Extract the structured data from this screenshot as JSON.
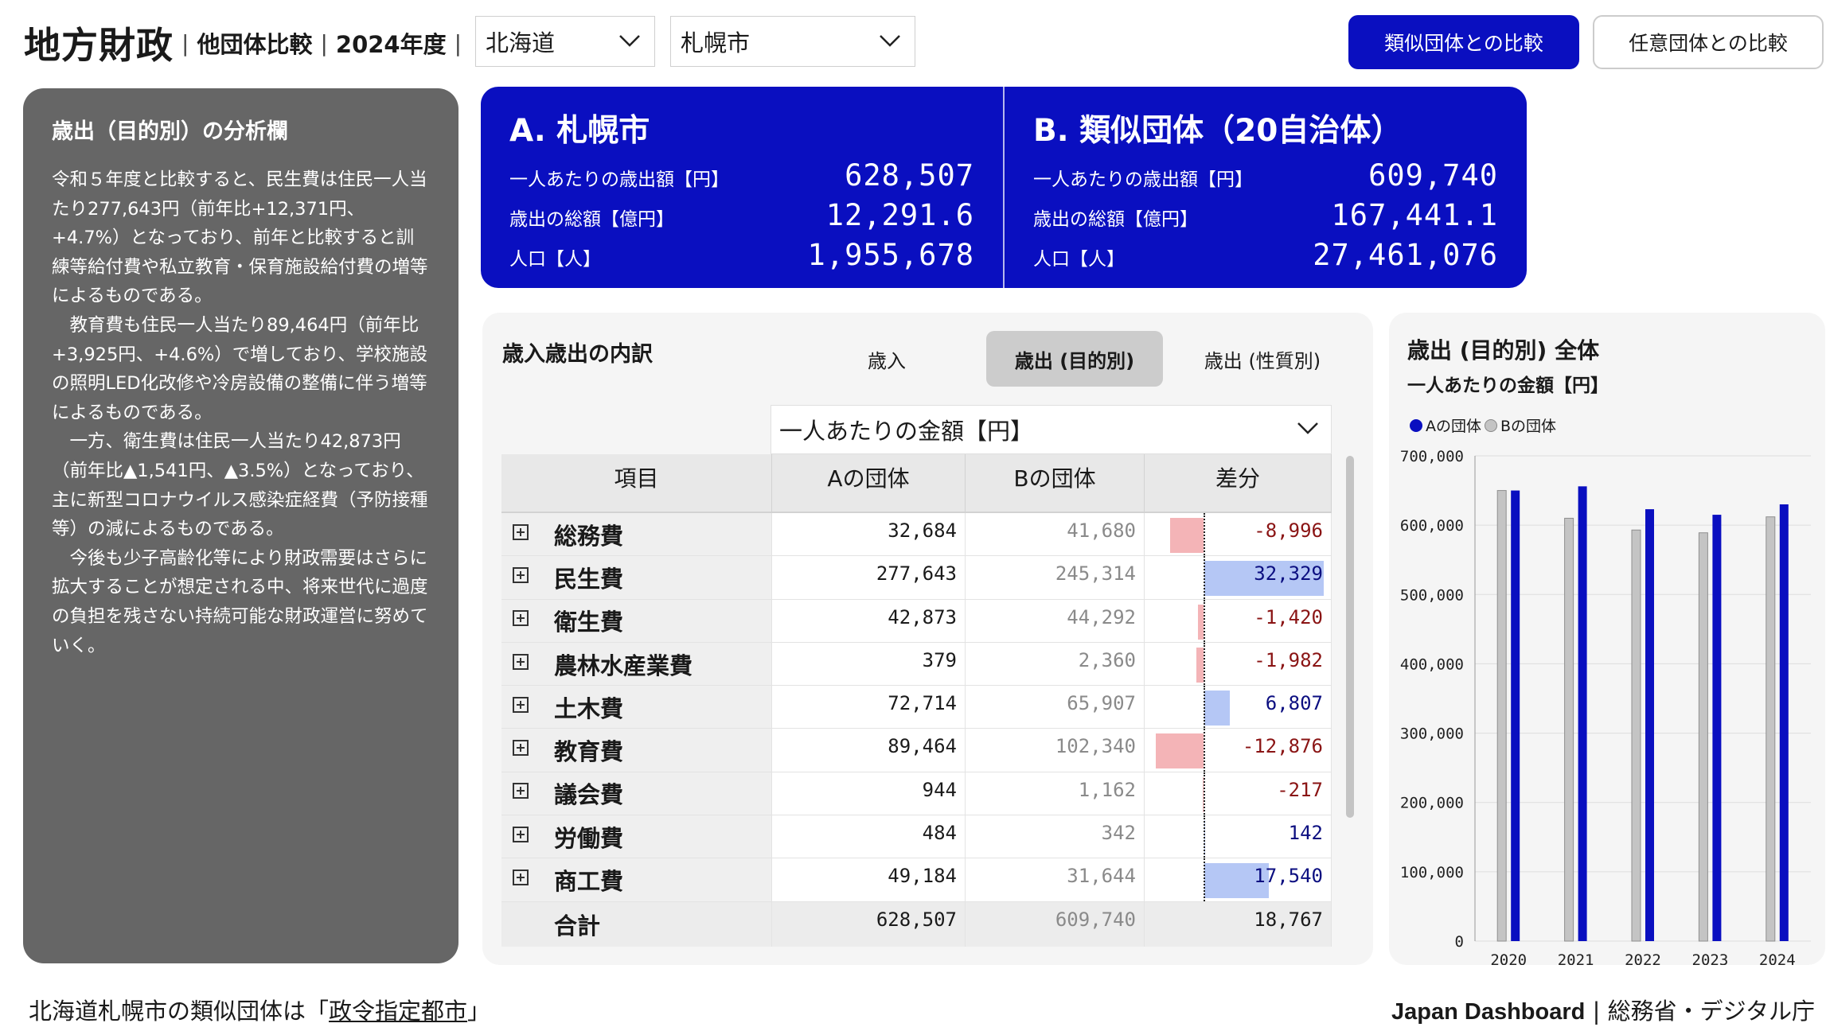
{
  "header": {
    "title": "地方財政",
    "separator": "|",
    "subtitle": "他団体比較",
    "year": "2024年度",
    "prefecture": "北海道",
    "city": "札幌市",
    "btn_similar": "類似団体との比較",
    "btn_any": "任意団体との比較"
  },
  "analysis": {
    "title": "歳出（目的別）の分析欄",
    "body": "令和５年度と比較すると、民生費は住民一人当たり277,643円（前年比+12,371円、+4.7%）となっており、前年と比較すると訓練等給付費や私立教育・保育施設給付費の増等によるものである。\n　教育費も住民一人当たり89,464円（前年比+3,925円、+4.6%）で増しており、学校施設の照明LED化改修や冷房設備の整備に伴う増等によるものである。\n　一方、衛生費は住民一人当たり42,873円（前年比▲1,541円、▲3.5%）となっており、主に新型コロナウイルス感染症経費（予防接種等）の減によるものである。\n　今後も少子高齢化等により財政需要はさらに拡大することが想定される中、将来世代に過度の負担を残さない持続可能な財政運営に努めていく。"
  },
  "summary": {
    "a": {
      "title": "A. 札幌市",
      "rows": [
        {
          "label": "一人あたりの歳出額【円】",
          "value": "628,507"
        },
        {
          "label": "歳出の総額【億円】",
          "value": "12,291.6"
        },
        {
          "label": "人口【人】",
          "value": "1,955,678"
        }
      ]
    },
    "b": {
      "title": "B. 類似団体（20自治体）",
      "rows": [
        {
          "label": "一人あたりの歳出額【円】",
          "value": "609,740"
        },
        {
          "label": "歳出の総額【億円】",
          "value": "167,441.1"
        },
        {
          "label": "人口【人】",
          "value": "27,461,076"
        }
      ]
    }
  },
  "breakdown": {
    "title": "歳入歳出の内訳",
    "tabs": [
      "歳入",
      "歳出 (目的別)",
      "歳出 (性質別)"
    ],
    "active_tab": 1,
    "metric": "一人あたりの金額【円】",
    "columns": [
      "項目",
      "Aの団体",
      "Bの団体",
      "差分"
    ],
    "rows": [
      {
        "name": "総務費",
        "a": "32,684",
        "b": "41,680",
        "diff": "-8,996",
        "diff_value": -8996
      },
      {
        "name": "民生費",
        "a": "277,643",
        "b": "245,314",
        "diff": "32,329",
        "diff_value": 32329
      },
      {
        "name": "衛生費",
        "a": "42,873",
        "b": "44,292",
        "diff": "-1,420",
        "diff_value": -1420
      },
      {
        "name": "農林水産業費",
        "a": "379",
        "b": "2,360",
        "diff": "-1,982",
        "diff_value": -1982
      },
      {
        "name": "土木費",
        "a": "72,714",
        "b": "65,907",
        "diff": "6,807",
        "diff_value": 6807
      },
      {
        "name": "教育費",
        "a": "89,464",
        "b": "102,340",
        "diff": "-12,876",
        "diff_value": -12876
      },
      {
        "name": "議会費",
        "a": "944",
        "b": "1,162",
        "diff": "-217",
        "diff_value": -217
      },
      {
        "name": "労働費",
        "a": "484",
        "b": "342",
        "diff": "142",
        "diff_value": 142
      },
      {
        "name": "商工費",
        "a": "49,184",
        "b": "31,644",
        "diff": "17,540",
        "diff_value": 17540
      }
    ],
    "total": {
      "name": "合計",
      "a": "628,507",
      "b": "609,740",
      "diff": "18,767"
    },
    "colors": {
      "negative_bar": "#f4b4b7",
      "positive_bar": "#b5c7f5"
    }
  },
  "chart": {
    "title": "歳出 (目的別) 全体",
    "subtitle": "一人あたりの金額【円】",
    "legend": [
      "Aの団体",
      "Bの団体"
    ]
  },
  "chart_data": {
    "type": "bar",
    "title": "歳出 (目的別) 全体",
    "ylabel": "一人あたりの金額【円】",
    "categories": [
      "2020",
      "2021",
      "2022",
      "2023",
      "2024"
    ],
    "series": [
      {
        "name": "Bの団体",
        "color": "#c4c4c4",
        "values": [
          650000,
          610000,
          593000,
          589000,
          612000
        ]
      },
      {
        "name": "Aの団体",
        "color": "#0a0fc0",
        "values": [
          650000,
          656000,
          623000,
          615000,
          630000
        ]
      }
    ],
    "ylim": [
      0,
      700000
    ],
    "yticks": [
      0,
      100000,
      200000,
      300000,
      400000,
      500000,
      600000,
      700000
    ],
    "ytick_labels": [
      "0",
      "100,000",
      "200,000",
      "300,000",
      "400,000",
      "500,000",
      "600,000",
      "700,000"
    ],
    "legend": "top-left",
    "grid": true
  },
  "footer": {
    "left_prefix": "北海道札幌市の類似団体は「",
    "left_link": "政令指定都市",
    "left_suffix": "」",
    "right_brand": "Japan Dashboard",
    "right_rest": " | 総務省・デジタル庁"
  },
  "colors": {
    "accent": "#0a0fc0",
    "panel_gray": "#666666"
  },
  "icons": [
    "chevron-down-icon",
    "plus-square-icon"
  ]
}
